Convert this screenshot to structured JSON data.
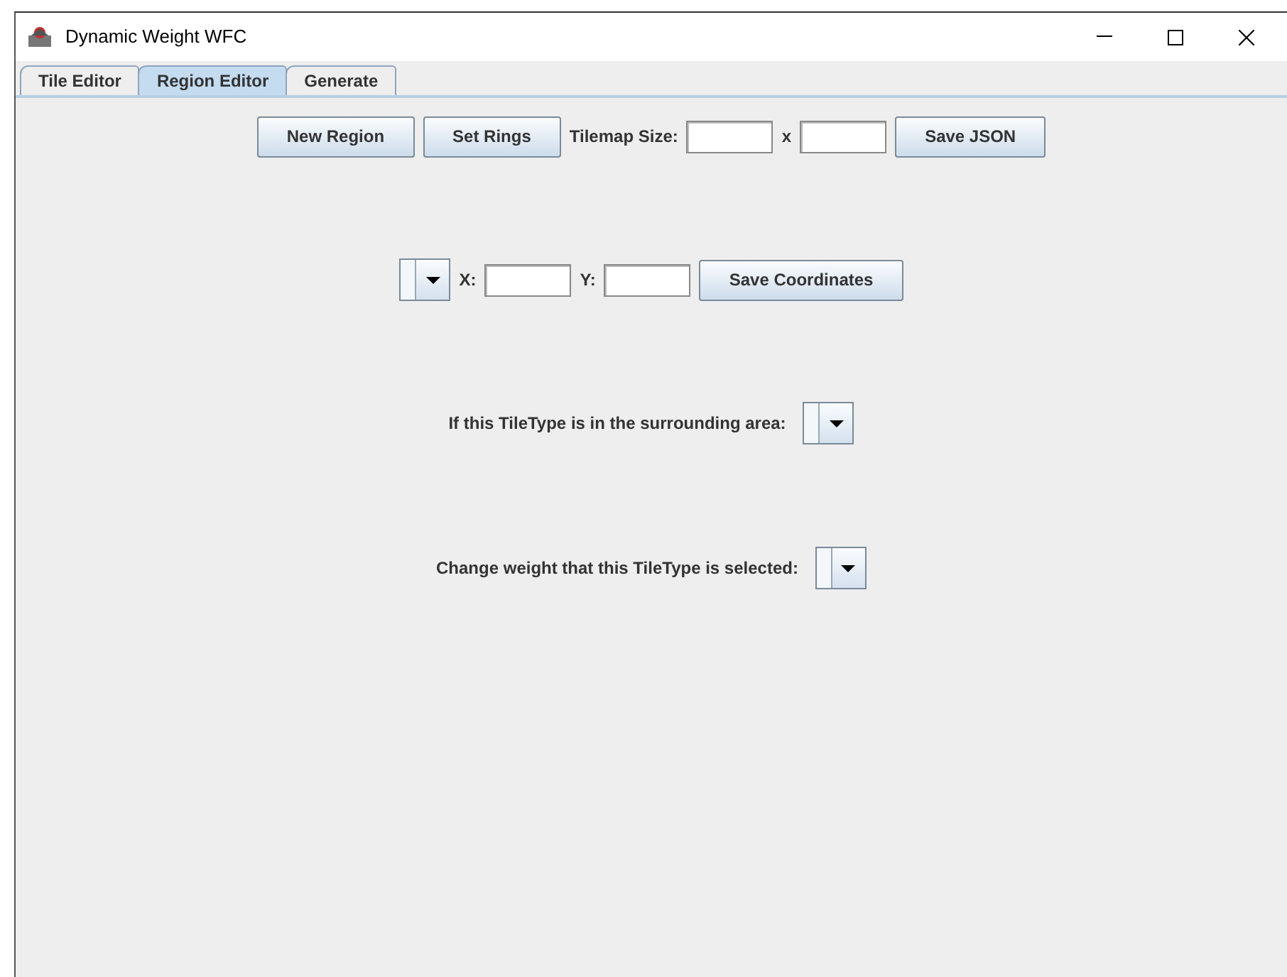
{
  "window": {
    "title": "Dynamic Weight WFC"
  },
  "tabs": [
    {
      "label": "Tile Editor",
      "selected": false
    },
    {
      "label": "Region Editor",
      "selected": true
    },
    {
      "label": "Generate",
      "selected": false
    }
  ],
  "rows": [
    [
      {
        "kind": "button",
        "label": "New Region"
      },
      {
        "kind": "button",
        "label": "Set Rings"
      },
      {
        "kind": "label",
        "text": "Tilemap Size:"
      },
      {
        "kind": "field"
      },
      {
        "kind": "label",
        "text": "x"
      },
      {
        "kind": "field"
      },
      {
        "kind": "button",
        "label": "Save JSON"
      }
    ],
    [
      {
        "kind": "combo"
      },
      {
        "kind": "label",
        "text": "X:"
      },
      {
        "kind": "field"
      },
      {
        "kind": "label",
        "text": "Y:"
      },
      {
        "kind": "field"
      },
      {
        "kind": "button",
        "label": "Save Coordinates"
      }
    ],
    [
      {
        "kind": "label",
        "text": "If this TileType is in the surrounding area:"
      },
      {
        "kind": "combo"
      }
    ],
    [
      {
        "kind": "label",
        "text": "Change weight that this TileType is selected:"
      },
      {
        "kind": "combo"
      }
    ]
  ]
}
